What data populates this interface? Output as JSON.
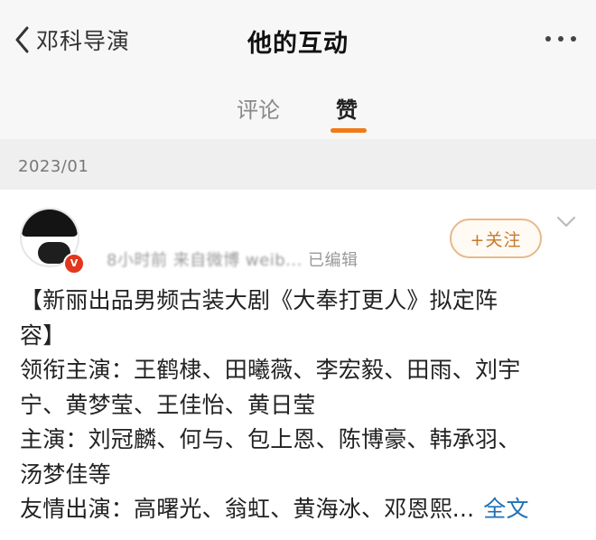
{
  "header": {
    "back_label": "邓科导演",
    "title": "他的互动"
  },
  "tabs": [
    {
      "label": "评论",
      "active": false
    },
    {
      "label": "赞",
      "active": true
    }
  ],
  "accent_color": "#f07a18",
  "date_label": "2023/01",
  "post": {
    "meta_time": "8小时前",
    "meta_source": "来自微博 weib...",
    "meta_edited": "已编辑",
    "follow_label": "+关注",
    "lines": [
      "【新丽出品男频古装大剧《大奉打更人》拟定阵",
      "容】",
      "领衔主演：王鹤棣、田曦薇、李宏毅、田雨、刘宇",
      "宁、黄梦莹、王佳怡、黄日莹",
      "主演：刘冠麟、何与、包上恩、陈博豪、韩承羽、",
      "汤梦佳等"
    ],
    "last_line": "友情出演：高曙光、翁虹、黄海冰、邓恩熙...",
    "full_text_link": "全文",
    "verified_badge": "V"
  }
}
